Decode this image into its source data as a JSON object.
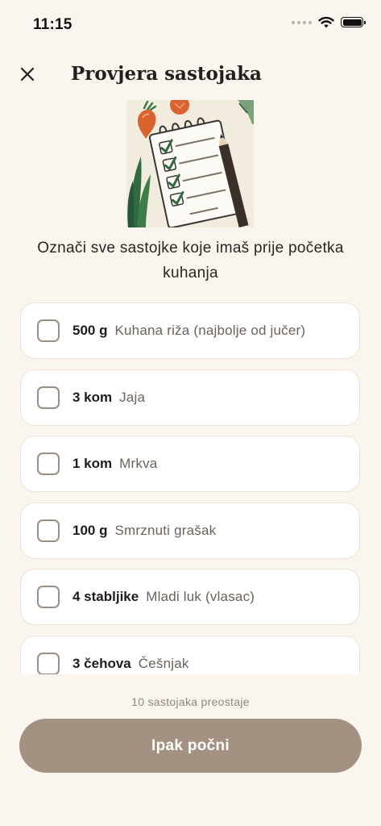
{
  "status_bar": {
    "time": "11:15"
  },
  "header": {
    "title": "Provjera sastojaka",
    "close_icon": "close-icon"
  },
  "hero_icon": "checklist-illustration",
  "instruction": "Označi sve sastojke koje imaš prije početka kuhanja",
  "ingredients": [
    {
      "quantity": "500 g",
      "name": "Kuhana riža (najbolje od jučer)",
      "checked": false
    },
    {
      "quantity": "3 kom",
      "name": "Jaja",
      "checked": false
    },
    {
      "quantity": "1 kom",
      "name": "Mrkva",
      "checked": false
    },
    {
      "quantity": "100 g",
      "name": "Smrznuti grašak",
      "checked": false
    },
    {
      "quantity": "4 stabljike",
      "name": "Mladi luk (vlasac)",
      "checked": false
    },
    {
      "quantity": "3 čehova",
      "name": "Češnjak",
      "checked": false
    }
  ],
  "footer": {
    "remaining": "10 sastojaka preostaje",
    "start_button": "Ipak počni"
  },
  "colors": {
    "background": "#faf5ee",
    "button": "#a39282",
    "checkbox_border": "#9b8f84"
  }
}
